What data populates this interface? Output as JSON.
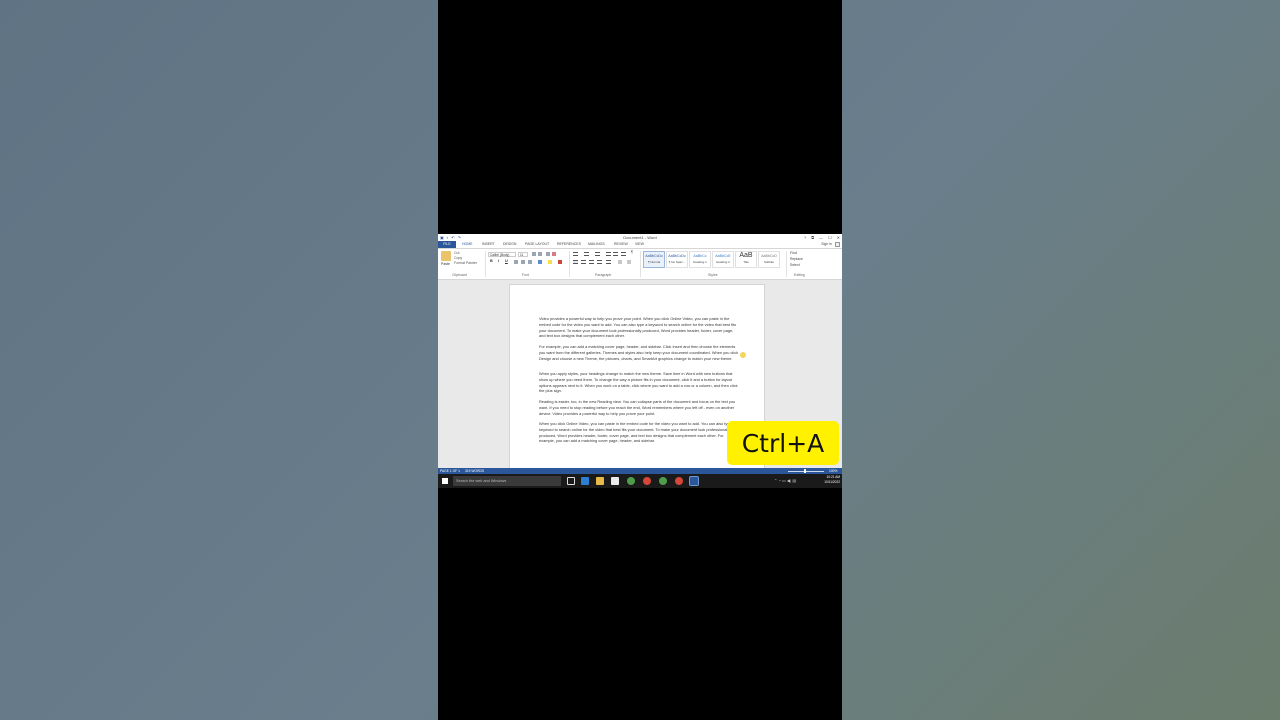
{
  "window": {
    "title": "Document1 - Word",
    "qat_icons": [
      "word-logo",
      "save",
      "undo",
      "redo"
    ],
    "controls": [
      "?",
      "⧉",
      "—",
      "☐",
      "✕"
    ]
  },
  "tabs": {
    "file": "FILE",
    "items": [
      "HOME",
      "INSERT",
      "DESIGN",
      "PAGE LAYOUT",
      "REFERENCES",
      "MAILINGS",
      "REVIEW",
      "VIEW"
    ],
    "active": "HOME",
    "sign_in": "Sign in"
  },
  "ribbon": {
    "clipboard": {
      "paste": "Paste",
      "cut": "Cut",
      "copy": "Copy",
      "format_painter": "Format Painter",
      "label": "Clipboard"
    },
    "font": {
      "name": "Calibri (Body)",
      "size": "11",
      "bold": "B",
      "italic": "I",
      "underline": "U",
      "label": "Font"
    },
    "paragraph": {
      "label": "Paragraph",
      "pilcrow": "¶"
    },
    "styles": {
      "label": "Styles",
      "items": [
        {
          "sample": "AaBbCcDc",
          "name": "¶ Normal"
        },
        {
          "sample": "AaBbCcDc",
          "name": "¶ No Spac..."
        },
        {
          "sample": "AaBbCc",
          "name": "Heading 1"
        },
        {
          "sample": "AaBbCcE",
          "name": "Heading 2"
        },
        {
          "sample": "AaB",
          "name": "Title"
        },
        {
          "sample": "AaBbCcD",
          "name": "Subtitle"
        }
      ]
    },
    "editing": {
      "label": "Editing",
      "find": "Find",
      "replace": "Replace",
      "select": "Select"
    }
  },
  "document": {
    "paragraphs": [
      "Video provides a powerful way to help you prove your point. When you click Online Video, you can paste in the embed code for the video you want to add. You can also type a keyword to search online for the video that best fits your document. To make your document look professionally produced, Word provides header, footer, cover page, and text box designs that complement each other.",
      "For example, you can add a matching cover page, header, and sidebar. Click Insert and then choose the elements you want from the different galleries. Themes and styles also help keep your document coordinated. When you click Design and choose a new Theme, the pictures, charts, and SmartArt graphics change to match your new theme.",
      "When you apply styles, your headings change to match the new theme. Save time in Word with new buttons that show up where you need them. To change the way a picture fits in your document, click it and a button for layout options appears next to it. When you work on a table, click where you want to add a row or a column, and then click the plus sign.",
      "Reading is easier, too, in the new Reading view. You can collapse parts of the document and focus on the text you want. If you need to stop reading before you reach the end, Word remembers where you left off - even on another device. Video provides a powerful way to help you prove your point.",
      "When you click Online Video, you can paste in the embed code for the video you want to add. You can also type a keyword to search online for the video that best fits your document. To make your document look professionally produced, Word provides header, footer, cover page, and text box designs that complement each other. For example, you can add a matching cover page, header, and sidebar."
    ]
  },
  "statusbar": {
    "page": "PAGE 1 OF 1",
    "words": "319 WORDS",
    "zoom": "100%"
  },
  "taskbar": {
    "search_placeholder": "Search the web and Windows",
    "time": "10:21 AM",
    "date": "10/11/2022",
    "apps": [
      "task-view",
      "edge",
      "file-explorer",
      "store",
      "chrome",
      "chrome",
      "chrome",
      "chrome",
      "word"
    ]
  },
  "overlay": {
    "shortcut": "Ctrl+A"
  },
  "colors": {
    "word_blue": "#2b579a",
    "badge_yellow": "#fff100",
    "taskbar": "#1a1a1a"
  }
}
